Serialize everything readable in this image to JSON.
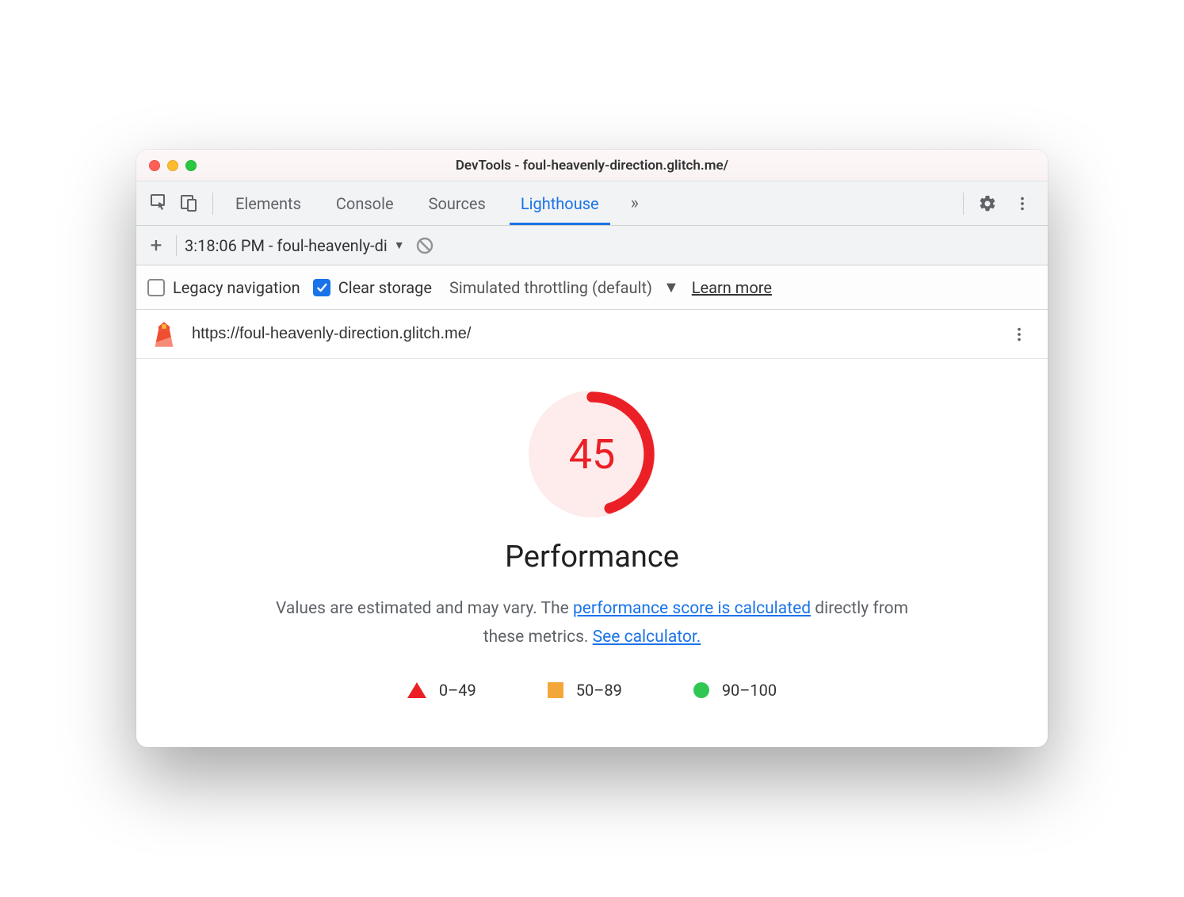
{
  "window": {
    "title": "DevTools - foul-heavenly-direction.glitch.me/"
  },
  "tabs": {
    "items": [
      "Elements",
      "Console",
      "Sources",
      "Lighthouse"
    ],
    "active": "Lighthouse"
  },
  "subtoolbar": {
    "report_label": "3:18:06 PM - foul-heavenly-di"
  },
  "options": {
    "legacy_label": "Legacy navigation",
    "legacy_checked": false,
    "clear_label": "Clear storage",
    "clear_checked": true,
    "throttle_label": "Simulated throttling (default)",
    "learn_more": "Learn more"
  },
  "report": {
    "url": "https://foul-heavenly-direction.glitch.me/",
    "score": "45",
    "score_fraction": 0.45,
    "category": "Performance",
    "desc_pre": "Values are estimated and may vary. The ",
    "desc_link1": "performance score is calculated",
    "desc_mid": " directly from these metrics. ",
    "desc_link2": "See calculator."
  },
  "legend": {
    "low": "0–49",
    "mid": "50–89",
    "high": "90–100"
  },
  "colors": {
    "accent": "#1a73e8",
    "fail": "#eb2026",
    "warn": "#f3a73b",
    "pass": "#2fc752"
  }
}
